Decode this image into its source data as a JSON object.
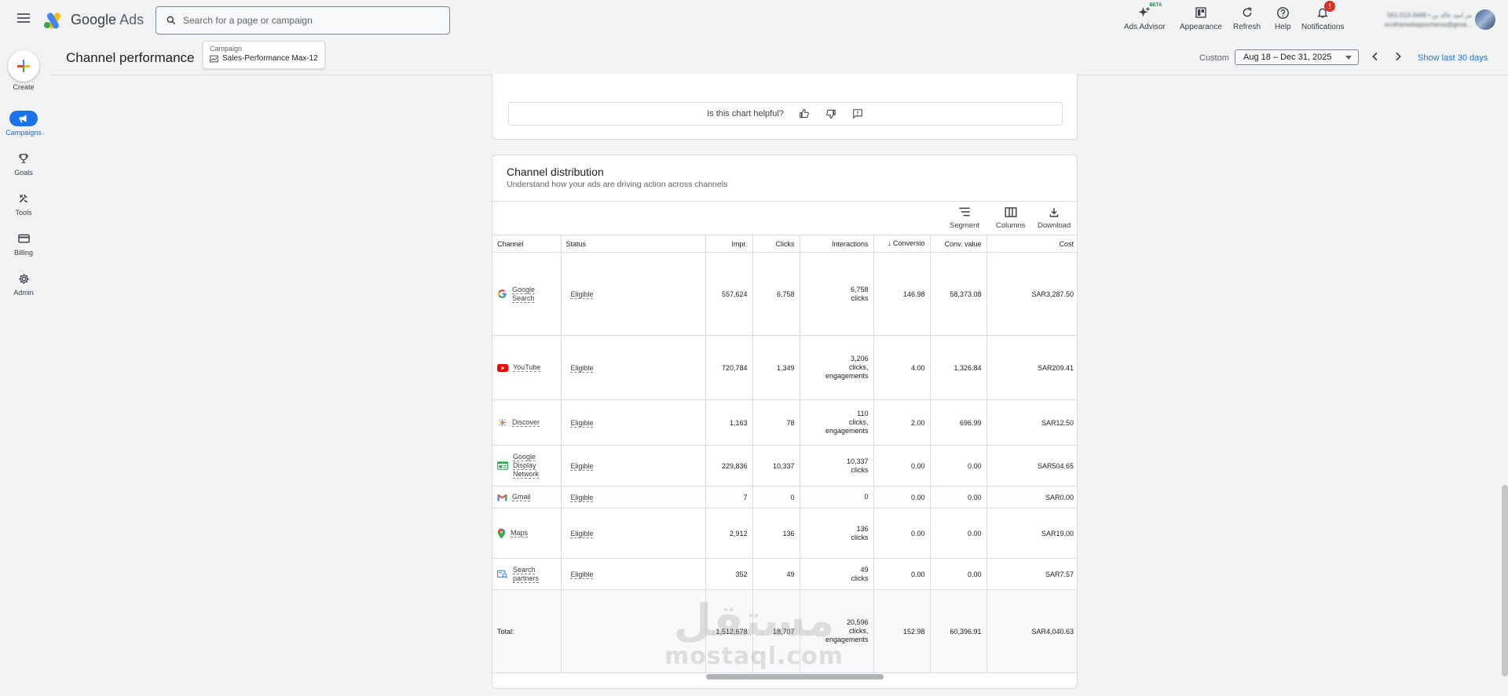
{
  "app": {
    "name_google": "Google",
    "name_ads": "Ads"
  },
  "search": {
    "placeholder": "Search for a page or campaign"
  },
  "toolbar": {
    "ads_advisor": "Ads Advisor",
    "beta": "BETA",
    "appearance": "Appearance",
    "refresh": "Refresh",
    "help": "Help",
    "notifications": "Notifications",
    "notifications_badge": "!"
  },
  "account": {
    "line1": "561-013-3448 • مر اسد خالد بن",
    "line2": "ecoframeitappschema@gmai..."
  },
  "nav": {
    "create": "Create",
    "items": [
      {
        "label": "Campaigns",
        "icon": "megaphone-icon"
      },
      {
        "label": "Goals",
        "icon": "trophy-icon"
      },
      {
        "label": "Tools",
        "icon": "tools-icon"
      },
      {
        "label": "Billing",
        "icon": "credit-card-icon"
      },
      {
        "label": "Admin",
        "icon": "gear-icon"
      }
    ]
  },
  "header": {
    "title": "Channel performance",
    "campaign_label": "Campaign",
    "campaign_value": "Sales-Performance Max-12",
    "custom_label": "Custom",
    "date_range": "Aug 18 – Dec 31, 2025",
    "show_last": "Show last 30 days"
  },
  "feedback": {
    "question": "Is this chart helpful?"
  },
  "channel_distribution": {
    "title": "Channel distribution",
    "subtitle": "Understand how your ads are driving action across channels",
    "tools": {
      "segment": "Segment",
      "columns": "Columns",
      "download": "Download"
    },
    "columns": [
      "Channel",
      "Status",
      "Impr.",
      "Clicks",
      "Interactions",
      "Conversio",
      "Conv. value",
      "Cost"
    ],
    "rows": [
      {
        "channel": [
          "Google",
          "Search"
        ],
        "icon": "google-g-icon",
        "status": "Eligible",
        "impr": "557,624",
        "clicks": "6,758",
        "interactions": [
          "6,758",
          "clicks"
        ],
        "conv": "146.98",
        "conv_value": "58,373.08",
        "cost": "SAR3,287.50"
      },
      {
        "channel": [
          "YouTube"
        ],
        "icon": "youtube-icon",
        "status": "Eligible",
        "impr": "720,784",
        "clicks": "1,349",
        "interactions": [
          "3,206",
          "clicks,",
          "engagements"
        ],
        "conv": "4.00",
        "conv_value": "1,326.84",
        "cost": "SAR209.41"
      },
      {
        "channel": [
          "Discover"
        ],
        "icon": "discover-icon",
        "status": "Eligible",
        "impr": "1,163",
        "clicks": "78",
        "interactions": [
          "110",
          "clicks,",
          "engagements"
        ],
        "conv": "2.00",
        "conv_value": "696.99",
        "cost": "SAR12.50"
      },
      {
        "channel": [
          "Google",
          "Display",
          "Network"
        ],
        "icon": "display-network-icon",
        "status": "Eligible",
        "impr": "229,836",
        "clicks": "10,337",
        "interactions": [
          "10,337",
          "clicks"
        ],
        "conv": "0.00",
        "conv_value": "0.00",
        "cost": "SAR504.65"
      },
      {
        "channel": [
          "Gmail"
        ],
        "icon": "gmail-icon",
        "status": "Eligible",
        "impr": "7",
        "clicks": "0",
        "interactions": [
          "0"
        ],
        "conv": "0.00",
        "conv_value": "0.00",
        "cost": "SAR0.00"
      },
      {
        "channel": [
          "Maps"
        ],
        "icon": "maps-pin-icon",
        "status": "Eligible",
        "impr": "2,912",
        "clicks": "136",
        "interactions": [
          "136",
          "clicks"
        ],
        "conv": "0.00",
        "conv_value": "0.00",
        "cost": "SAR19.00"
      },
      {
        "channel": [
          "Search",
          "partners"
        ],
        "icon": "search-partners-icon",
        "status": "Eligible",
        "impr": "352",
        "clicks": "49",
        "interactions": [
          "49",
          "clicks"
        ],
        "conv": "0.00",
        "conv_value": "0.00",
        "cost": "SAR7.57"
      }
    ],
    "total": {
      "label": "Total:",
      "impr": "1,512,678",
      "clicks": "18,707",
      "interactions": [
        "20,596",
        "clicks,",
        "engagements"
      ],
      "conv": "152.98",
      "conv_value": "60,396.91",
      "cost": "SAR4,040.63"
    }
  },
  "watermark": {
    "line1": "مستقل",
    "line2": "mostaql.com"
  },
  "colors": {
    "accent": "#1a73e8",
    "nav_active": "#1967d2",
    "badge": "#d93025"
  }
}
